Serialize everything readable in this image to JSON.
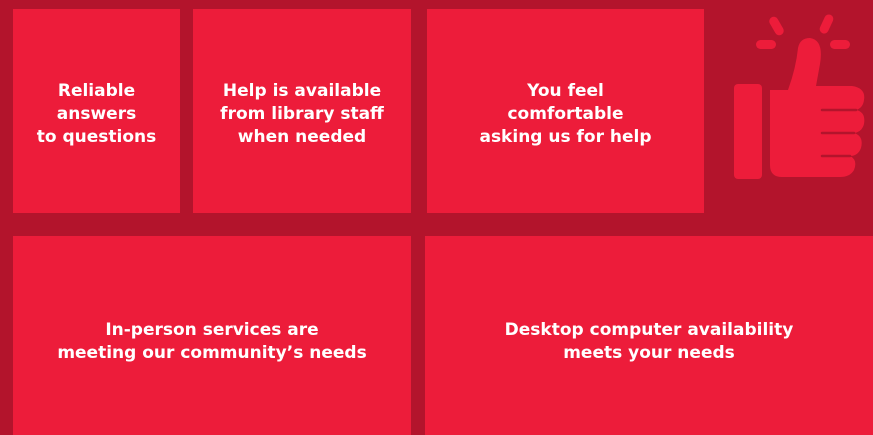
{
  "tiles": [
    {
      "lines": [
        "Reliable",
        "answers",
        "to questions"
      ]
    },
    {
      "lines": [
        "Help is available",
        "from library staff",
        "when needed"
      ]
    },
    {
      "lines": [
        "You feel",
        "comfortable",
        "asking us for help"
      ]
    },
    {
      "lines": [
        "In-person services are",
        "meeting our community’s needs"
      ]
    },
    {
      "lines": [
        "Desktop computer availability",
        "meets your needs"
      ]
    }
  ],
  "icons": {
    "thumb": "thumbs-up-icon"
  },
  "colors": {
    "background": "#b3142c",
    "tile": "#ed1c3a",
    "text": "#ffffff"
  }
}
